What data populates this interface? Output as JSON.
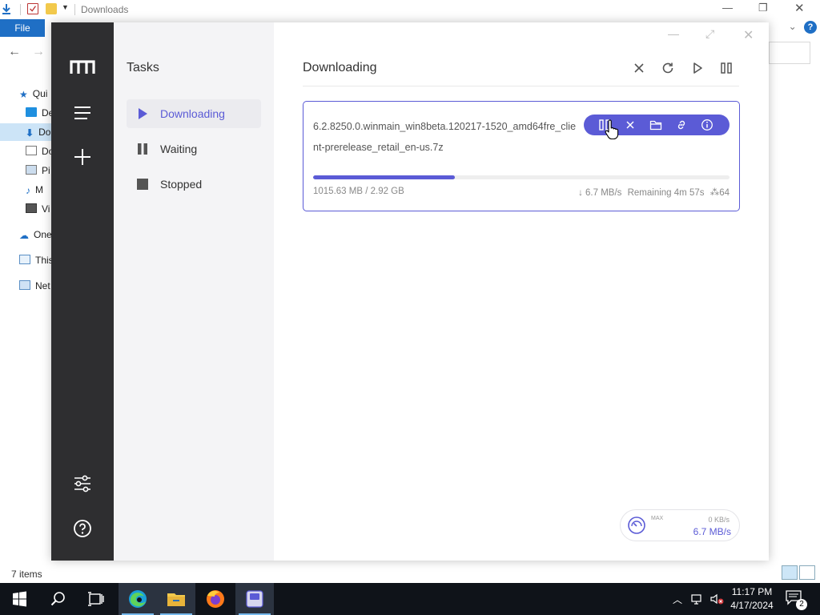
{
  "explorer": {
    "title": "Downloads",
    "file_tab": "File",
    "nav_items": [
      "Qui",
      "De",
      "Do",
      "Do",
      "Pi",
      "M",
      "Vi",
      "One",
      "This",
      "Net"
    ],
    "status": "7 items"
  },
  "motrix": {
    "tasks_title": "Tasks",
    "task_list": [
      {
        "label": "Downloading",
        "icon": "play-icon",
        "active": true
      },
      {
        "label": "Waiting",
        "icon": "pause-icon",
        "active": false
      },
      {
        "label": "Stopped",
        "icon": "stop-icon",
        "active": false
      }
    ],
    "main_title": "Downloading",
    "task": {
      "name": "6.2.8250.0.winmain_win8beta.120217-1520_amd64fre_client-prerelease_retail_en-us.7z",
      "size": "1015.63 MB / 2.92 GB",
      "speed": "↓ 6.7 MB/s",
      "remaining": "Remaining 4m 57s",
      "connections": "64",
      "progress_fraction": 0.34
    },
    "speedometer": {
      "max_label": "MAX",
      "limit": "0 KB/s",
      "current": "6.7 MB/s"
    },
    "accent_color": "#5b5bd6",
    "sidebar_color": "#2e2e30"
  },
  "taskbar": {
    "time": "11:17 PM",
    "date": "4/17/2024",
    "notification_count": "2"
  }
}
